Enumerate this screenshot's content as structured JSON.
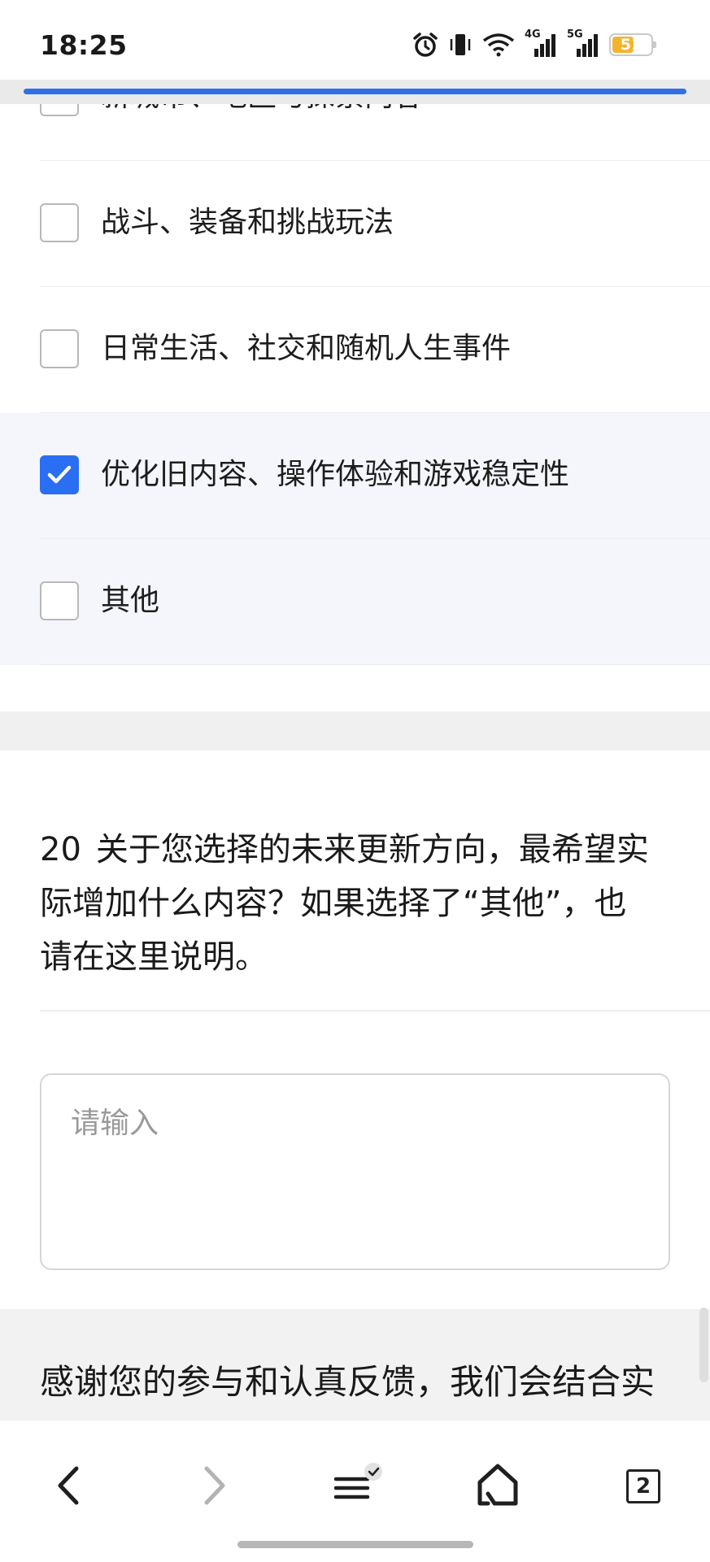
{
  "status_bar": {
    "time": "18:25",
    "icons": [
      "alarm-icon",
      "vibrate-icon",
      "wifi-icon",
      "signal-4g-icon",
      "signal-5g-icon"
    ],
    "net_4g": "4G",
    "net_5g": "5G",
    "battery_level": "51",
    "battery_color": "#f2b430"
  },
  "page": {
    "progress_color": "#2f6fe8",
    "options": [
      {
        "label": "新城市、地区与探索内容",
        "checked": false
      },
      {
        "label": "战斗、装备和挑战玩法",
        "checked": false
      },
      {
        "label": "日常生活、社交和随机人生事件",
        "checked": false
      },
      {
        "label": "优化旧内容、操作体验和游戏稳定性",
        "checked": true
      },
      {
        "label": "其他",
        "checked": false
      }
    ],
    "question": {
      "number": "20",
      "text": "关于您选择的未来更新方向，最希望实际增加什么内容？如果选择了“其他”，也请在这里说明。"
    },
    "answer": {
      "placeholder": "请输入",
      "value": ""
    },
    "thanks_text": "感谢您的参与和认真反馈，我们会结合实际体验人数和具体建议整理本次调查"
  },
  "bottom_nav": {
    "items": [
      "back-icon",
      "forward-icon",
      "menu-icon",
      "home-icon",
      "tabs-icon"
    ],
    "tab_count": "2"
  },
  "accent_color": "#2a6ef2"
}
